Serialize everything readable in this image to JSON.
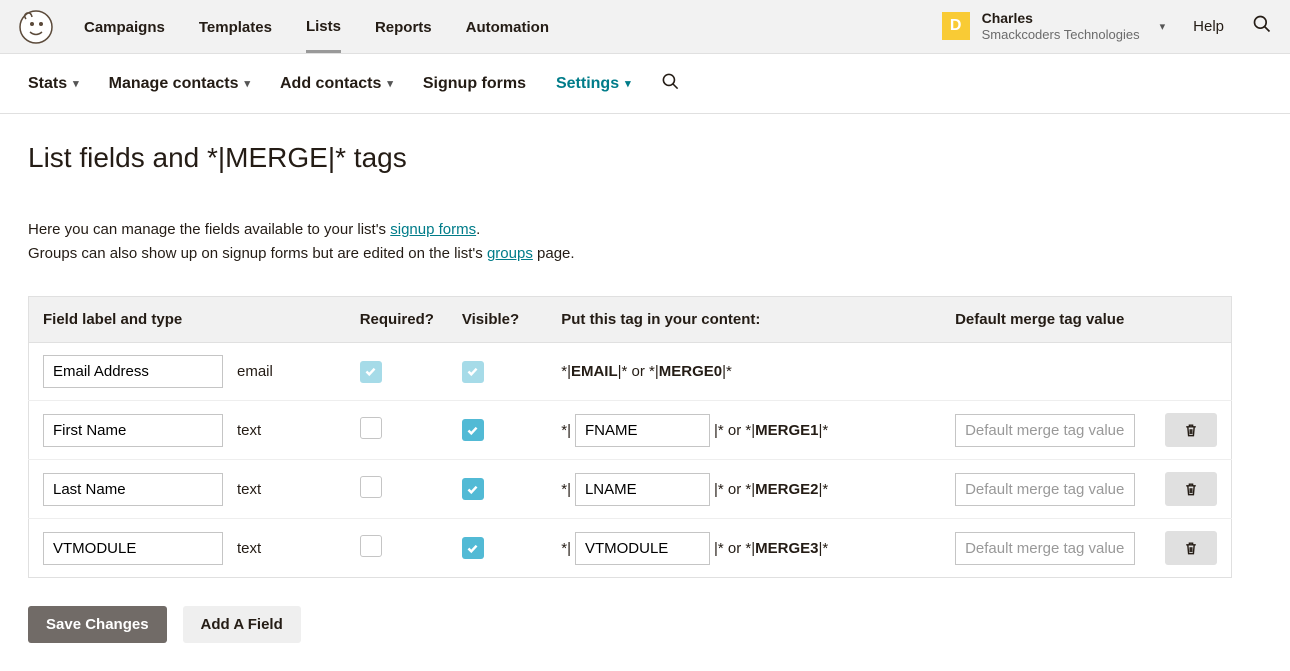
{
  "header": {
    "nav": {
      "campaigns": "Campaigns",
      "templates": "Templates",
      "lists": "Lists",
      "reports": "Reports",
      "automation": "Automation"
    },
    "user": {
      "initial": "D",
      "name": "Charles",
      "org": "Smackcoders Technologies"
    },
    "help": "Help"
  },
  "subnav": {
    "stats": "Stats",
    "manage_contacts": "Manage contacts",
    "add_contacts": "Add contacts",
    "signup_forms": "Signup forms",
    "settings": "Settings"
  },
  "page": {
    "title": "List fields and *|MERGE|* tags",
    "desc_prefix": "Here you can manage the fields available to your list's ",
    "desc_link1": "signup forms",
    "desc_mid": ".",
    "desc_line2_prefix": "Groups can also show up on signup forms but are edited on the list's ",
    "desc_link2": "groups",
    "desc_line2_suffix": " page."
  },
  "table": {
    "headers": {
      "label": "Field label and type",
      "required": "Required?",
      "visible": "Visible?",
      "tag": "Put this tag in your content:",
      "default": "Default merge tag value"
    },
    "rows": [
      {
        "label": "Email Address",
        "type": "email",
        "required_locked": true,
        "required": true,
        "visible_locked": true,
        "visible": true,
        "tag_static": true,
        "tag_text_prefix": "*|",
        "tag_text_bold1": "EMAIL",
        "tag_text_mid1": "|* or *|",
        "tag_text_bold2": "MERGE0",
        "tag_text_suffix": "|*",
        "deletable": false
      },
      {
        "label": "First Name",
        "type": "text",
        "required_locked": false,
        "required": false,
        "visible_locked": false,
        "visible": true,
        "tag_static": false,
        "tag_value": "FNAME",
        "merge_num": "MERGE1",
        "deletable": true
      },
      {
        "label": "Last Name",
        "type": "text",
        "required_locked": false,
        "required": false,
        "visible_locked": false,
        "visible": true,
        "tag_static": false,
        "tag_value": "LNAME",
        "merge_num": "MERGE2",
        "deletable": true
      },
      {
        "label": "VTMODULE",
        "type": "text",
        "required_locked": false,
        "required": false,
        "visible_locked": false,
        "visible": true,
        "tag_static": false,
        "tag_value": "VTMODULE",
        "merge_num": "MERGE3",
        "deletable": true
      }
    ],
    "default_placeholder": "Default merge tag value",
    "tag_prefix": "*|",
    "tag_sep": "|* or *|",
    "tag_suffix": "|*"
  },
  "buttons": {
    "save": "Save Changes",
    "add": "Add A Field"
  }
}
